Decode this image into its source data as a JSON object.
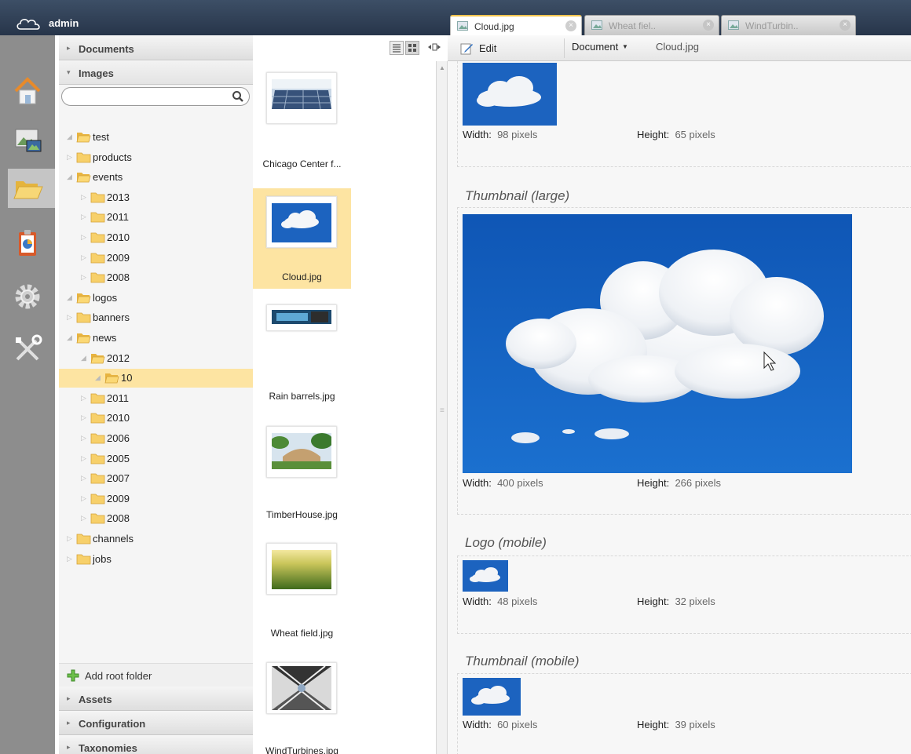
{
  "header": {
    "user": "admin"
  },
  "tabs": [
    {
      "label": "Cloud.jpg",
      "active": true
    },
    {
      "label": "Wheat fiel..",
      "active": false
    },
    {
      "label": "WindTurbin..",
      "active": false
    }
  ],
  "sidebar": {
    "sections": {
      "documents": "Documents",
      "images": "Images",
      "assets": "Assets",
      "configuration": "Configuration",
      "taxonomies": "Taxonomies"
    },
    "search": {
      "value": "",
      "placeholder": ""
    },
    "tree": [
      {
        "label": "test",
        "level": 0,
        "expanded": true
      },
      {
        "label": "products",
        "level": 0,
        "expanded": false
      },
      {
        "label": "events",
        "level": 0,
        "expanded": true
      },
      {
        "label": "2013",
        "level": 1,
        "expanded": false
      },
      {
        "label": "2011",
        "level": 1,
        "expanded": false
      },
      {
        "label": "2010",
        "level": 1,
        "expanded": false
      },
      {
        "label": "2009",
        "level": 1,
        "expanded": false
      },
      {
        "label": "2008",
        "level": 1,
        "expanded": false
      },
      {
        "label": "logos",
        "level": 0,
        "expanded": true
      },
      {
        "label": "banners",
        "level": 0,
        "expanded": false
      },
      {
        "label": "news",
        "level": 0,
        "expanded": true
      },
      {
        "label": "2012",
        "level": 1,
        "expanded": true
      },
      {
        "label": "10",
        "level": 2,
        "expanded": true,
        "selected": true
      },
      {
        "label": "2011",
        "level": 1,
        "expanded": false
      },
      {
        "label": "2010",
        "level": 1,
        "expanded": false
      },
      {
        "label": "2006",
        "level": 1,
        "expanded": false
      },
      {
        "label": "2005",
        "level": 1,
        "expanded": false
      },
      {
        "label": "2007",
        "level": 1,
        "expanded": false
      },
      {
        "label": "2009",
        "level": 1,
        "expanded": false
      },
      {
        "label": "2008",
        "level": 1,
        "expanded": false
      },
      {
        "label": "channels",
        "level": 0,
        "expanded": false
      },
      {
        "label": "jobs",
        "level": 0,
        "expanded": false
      }
    ],
    "add_root_label": "Add root folder"
  },
  "files": [
    {
      "name": "Chicago Center f...",
      "thumb": "solar-panels"
    },
    {
      "name": "Cloud.jpg",
      "thumb": "cloud",
      "selected": true
    },
    {
      "name": "Rain barrels.jpg",
      "thumb": "rain-barrels"
    },
    {
      "name": "TimberHouse.jpg",
      "thumb": "timber-house"
    },
    {
      "name": "Wheat field.jpg",
      "thumb": "wheat-field"
    },
    {
      "name": "WindTurbines.jpg",
      "thumb": "wind-turbines"
    }
  ],
  "toolbar": {
    "edit_label": "Edit",
    "document_dropdown": "Document",
    "filename": "Cloud.jpg"
  },
  "content": {
    "width_label": "Width:",
    "height_label": "Height:",
    "sections": [
      {
        "title": "",
        "width": "98 pixels",
        "height": "65 pixels"
      },
      {
        "title": "Thumbnail (large)",
        "width": "400 pixels",
        "height": "266 pixels"
      },
      {
        "title": "Logo (mobile)",
        "width": "48 pixels",
        "height": "32 pixels"
      },
      {
        "title": "Thumbnail (mobile)",
        "width": "60 pixels",
        "height": "39 pixels"
      }
    ]
  },
  "colors": {
    "topbar": "#2e3d53",
    "selection": "#fde4a2",
    "rail": "#8d8d8d",
    "sky": "#1560c0"
  }
}
